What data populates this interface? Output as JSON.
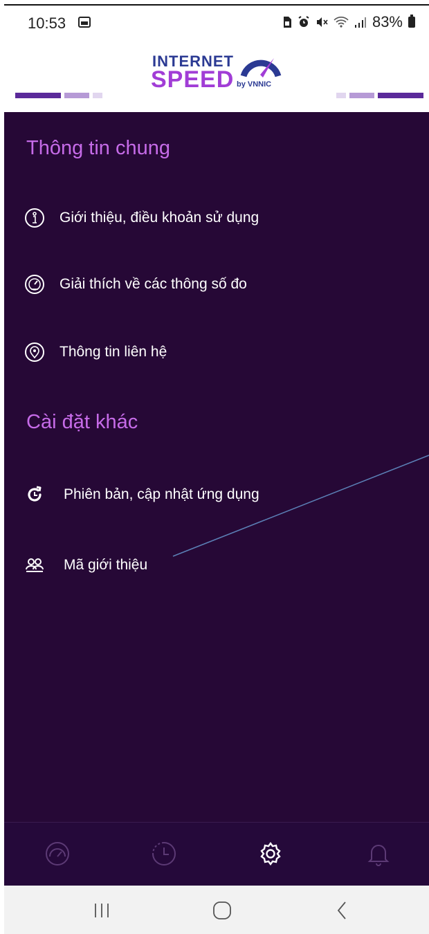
{
  "status_bar": {
    "time": "10:53",
    "battery_percent": "83%",
    "icons": [
      "image-icon",
      "sim-icon",
      "alarm-icon",
      "mute-icon",
      "wifi-icon",
      "signal-icon",
      "battery-icon"
    ]
  },
  "header": {
    "logo": {
      "line1": "INTERNET",
      "line2": "SPEED",
      "byline": "by VNNIC"
    },
    "colors": {
      "brand_blue": "#2b3a93",
      "brand_purple": "#a13dd6",
      "bar_dark": "#5b2a9a",
      "bar_mid": "#b69ad6",
      "bar_light": "#e1d6ef"
    }
  },
  "sections": [
    {
      "title": "Thông tin chung",
      "items": [
        {
          "label": "Giới thiệu, điều khoản sử dụng",
          "icon": "info-icon"
        },
        {
          "label": "Giải thích về các thông số đo",
          "icon": "speedometer-icon"
        },
        {
          "label": "Thông tin liên hệ",
          "icon": "location-pin-icon"
        }
      ]
    },
    {
      "title": "Cài đặt khác",
      "items": [
        {
          "label": "Phiên bản, cập nhật ứng dụng",
          "icon": "refresh-icon"
        },
        {
          "label": "Mã giới thiệu",
          "icon": "users-icon"
        }
      ]
    }
  ],
  "bottom_nav": {
    "items": [
      {
        "icon": "speedometer-icon",
        "active": false
      },
      {
        "icon": "history-clock-icon",
        "active": false
      },
      {
        "icon": "settings-gear-icon",
        "active": true
      },
      {
        "icon": "bell-icon",
        "active": false
      }
    ]
  },
  "system_nav": [
    "recents-icon",
    "home-icon",
    "back-icon"
  ],
  "colors": {
    "panel_bg": "#260836",
    "section_title": "#c66be8",
    "item_text": "#ffffff",
    "nav_inactive": "#5c3a75",
    "nav_active": "#ffffff",
    "annotation_line": "#5b7fb5"
  }
}
